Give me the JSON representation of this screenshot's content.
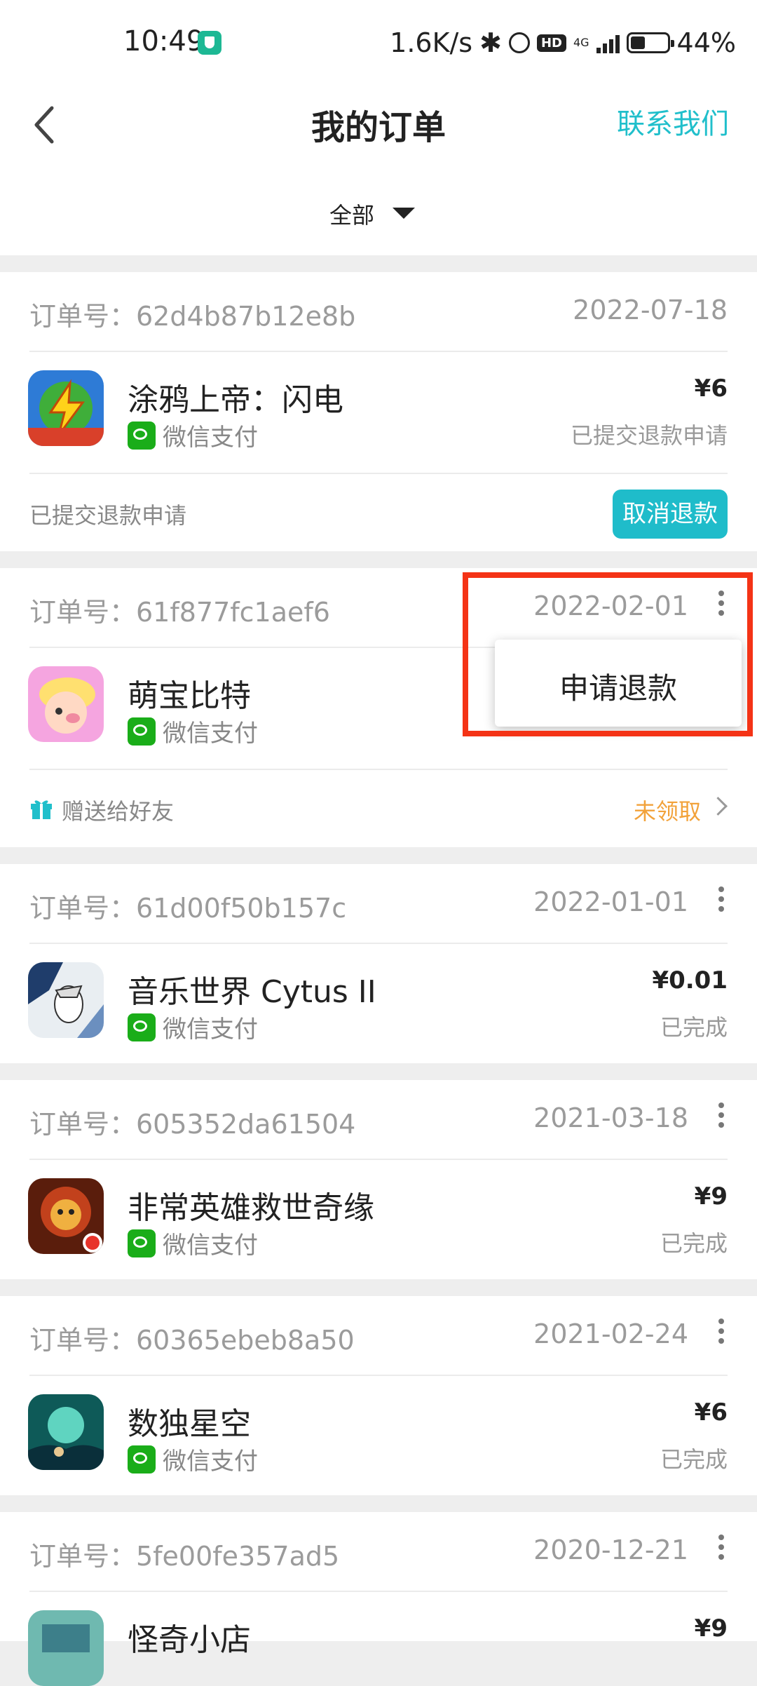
{
  "status_bar": {
    "time": "10:49",
    "network_speed": "1.6K/s",
    "signal_label": "4G",
    "battery": "44%",
    "colors": {
      "shield": "#1db894"
    }
  },
  "header": {
    "title": "我的订单",
    "contact_link": "联系我们",
    "back_icon": "chevron-left-icon"
  },
  "filter": {
    "label": "全部"
  },
  "orders": [
    {
      "order_no": "订单号：62d4b87b12e8b",
      "date": "2022-07-18",
      "name": "涂鸦上帝：闪电",
      "payment": "微信支付",
      "price": "¥6",
      "status": "已提交退款申请",
      "footer_text": "已提交退款申请",
      "footer_button": "取消退款"
    },
    {
      "order_no": "订单号：61f877fc1aef6",
      "date": "2022-02-01",
      "name": "萌宝比特",
      "payment": "微信支付",
      "gift_text": "赠送给好友",
      "gift_status": "未领取"
    },
    {
      "order_no": "订单号：61d00f50b157c",
      "date": "2022-01-01",
      "name": "音乐世界 Cytus II",
      "payment": "微信支付",
      "price": "¥0.01",
      "status": "已完成"
    },
    {
      "order_no": "订单号：605352da61504",
      "date": "2021-03-18",
      "name": "非常英雄救世奇缘",
      "payment": "微信支付",
      "price": "¥9",
      "status": "已完成"
    },
    {
      "order_no": "订单号：60365ebeb8a50",
      "date": "2021-02-24",
      "name": "数独星空",
      "payment": "微信支付",
      "price": "¥6",
      "status": "已完成"
    },
    {
      "order_no": "订单号：5fe00fe357ad5",
      "date": "2020-12-21",
      "name": "怪奇小店",
      "price": "¥9"
    }
  ],
  "popup_menu": {
    "item": "申请退款"
  },
  "colors": {
    "accent": "#20bfcb",
    "button": "#1fbcca",
    "highlight": "#f43316",
    "gift_status": "#f2a23a",
    "wechat": "#1aad19"
  }
}
